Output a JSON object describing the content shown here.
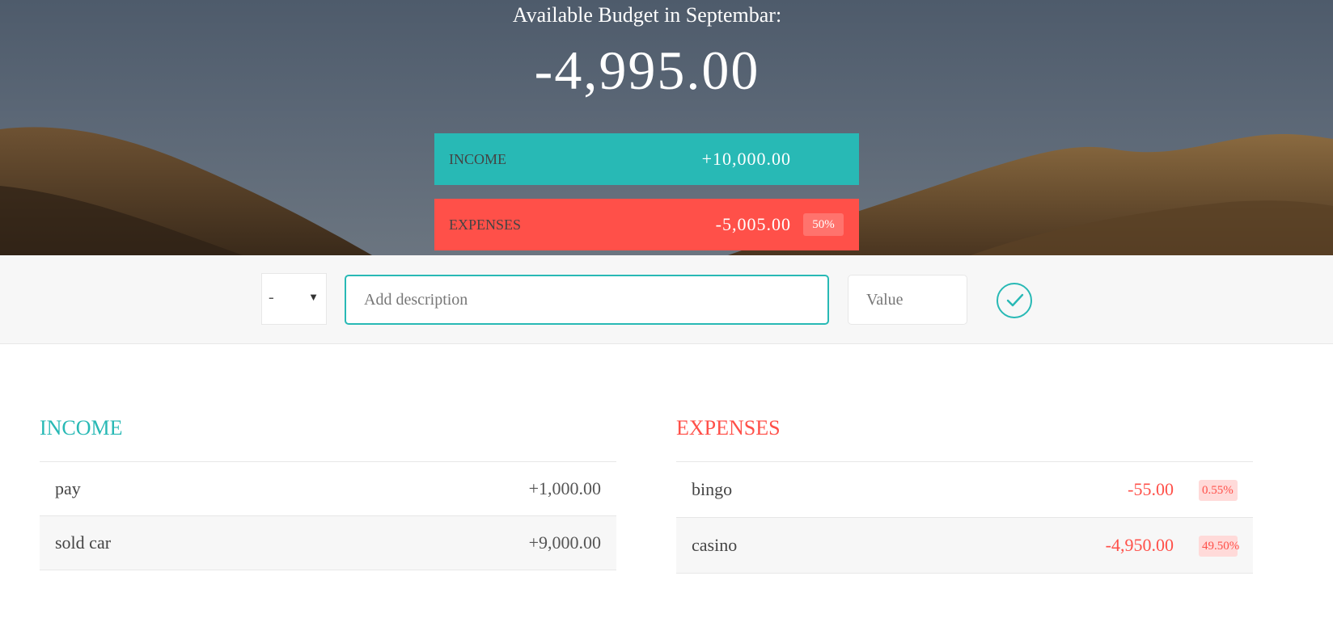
{
  "header": {
    "budget_title": "Available Budget in Septembar:",
    "budget_value": "-4,995.00",
    "income": {
      "label": "Income",
      "value": "+10,000.00"
    },
    "expenses": {
      "label": "Expenses",
      "value": "-5,005.00",
      "percentage": "50%"
    }
  },
  "add_bar": {
    "type_value": "-",
    "description_placeholder": "Add description",
    "value_placeholder": "Value",
    "submit_icon": "check-icon"
  },
  "income_list": {
    "title": "Income",
    "items": [
      {
        "description": "pay",
        "value": "+1,000.00"
      },
      {
        "description": "sold car",
        "value": "+9,000.00"
      }
    ]
  },
  "expenses_list": {
    "title": "Expenses",
    "items": [
      {
        "description": "bingo",
        "value": "-55.00",
        "percentage": "0.55%"
      },
      {
        "description": "casino",
        "value": "-4,950.00",
        "percentage": "49.50%"
      }
    ]
  },
  "colors": {
    "income": "#28b9b5",
    "expenses": "#ff5049"
  }
}
